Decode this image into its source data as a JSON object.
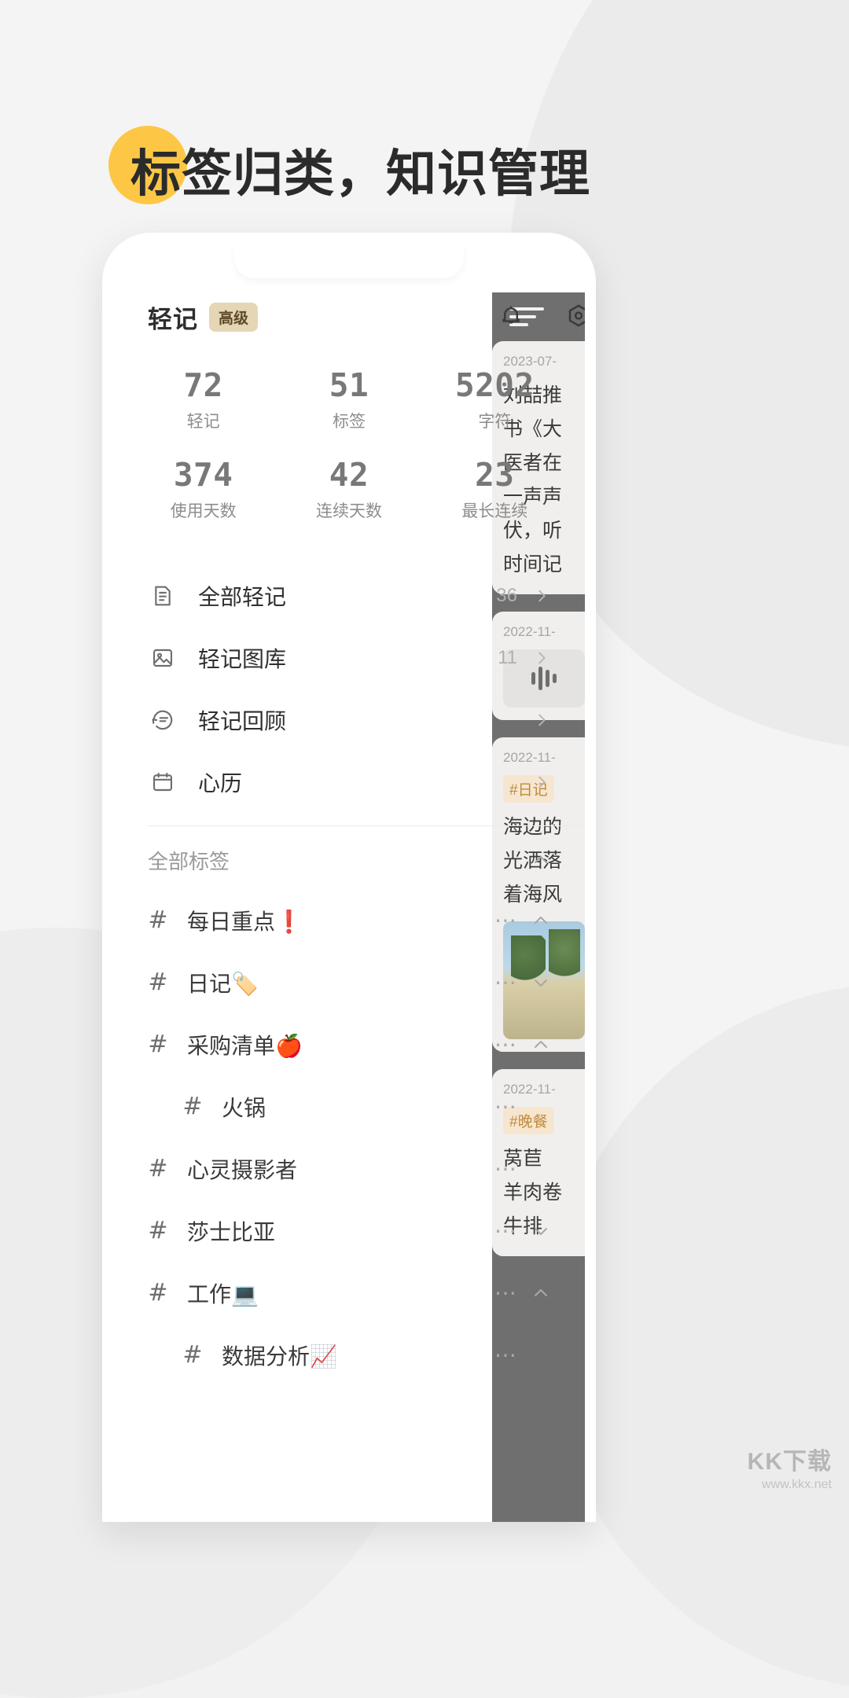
{
  "headline": {
    "text": "标签归类，知识管理"
  },
  "app": {
    "title": "轻记",
    "badge": "高级",
    "icons": {
      "bell": "bell-icon",
      "settings": "settings-hex-icon"
    }
  },
  "stats": [
    {
      "value": "72",
      "label": "轻记"
    },
    {
      "value": "51",
      "label": "标签"
    },
    {
      "value": "5202",
      "label": "字符"
    },
    {
      "value": "374",
      "label": "使用天数"
    },
    {
      "value": "42",
      "label": "连续天数"
    },
    {
      "value": "23",
      "label": "最长连续"
    }
  ],
  "menu": [
    {
      "label": "全部轻记",
      "count": "36",
      "icon": "document-icon"
    },
    {
      "label": "轻记图库",
      "count": "11",
      "icon": "image-icon"
    },
    {
      "label": "轻记回顾",
      "count": "",
      "icon": "review-icon"
    },
    {
      "label": "心历",
      "count": "",
      "icon": "calendar-icon"
    }
  ],
  "tags_section": {
    "header": "全部标签",
    "collapse_icon": "chevron-up-icon",
    "items": [
      {
        "name": "每日重点❗",
        "nested": false,
        "dots": "⋯",
        "caret": "up"
      },
      {
        "name": "日记🏷️",
        "nested": false,
        "dots": "⋯",
        "caret": "down"
      },
      {
        "name": "采购清单🍎",
        "nested": false,
        "dots": "⋯",
        "caret": "up"
      },
      {
        "name": "火锅",
        "nested": true,
        "dots": "⋯",
        "caret": "none"
      },
      {
        "name": "心灵摄影者",
        "nested": false,
        "dots": "⋯",
        "caret": "none"
      },
      {
        "name": "莎士比亚",
        "nested": false,
        "dots": "⋯",
        "caret": "down"
      },
      {
        "name": "工作💻",
        "nested": false,
        "dots": "⋯",
        "caret": "up"
      },
      {
        "name": "数据分析📈",
        "nested": true,
        "dots": "⋯",
        "caret": "none"
      }
    ]
  },
  "note_panel": {
    "menu_icon": "hamburger-icon",
    "notes": [
      {
        "date": "2023-07-",
        "lines": [
          "刘喆推",
          "书《大",
          "医者在",
          "一声声",
          "伏，听",
          "时间记"
        ]
      },
      {
        "date": "2022-11-",
        "type": "audio"
      },
      {
        "date": "2022-11-",
        "tag": "#日记",
        "lines": [
          "海边的",
          "光洒落",
          "着海风"
        ],
        "photo": true
      },
      {
        "date": "2022-11-",
        "tag": "#晚餐",
        "lines": [
          "莴苣",
          "羊肉卷",
          "牛排"
        ]
      }
    ]
  },
  "watermark": {
    "main": "KK下载",
    "sub": "www.kkx.net"
  },
  "colors": {
    "accent_yellow": "#fdc745",
    "badge_bg": "#e5d6b6",
    "panel_gray": "#6f6f6f",
    "tag_orange": "#c08a3e"
  }
}
